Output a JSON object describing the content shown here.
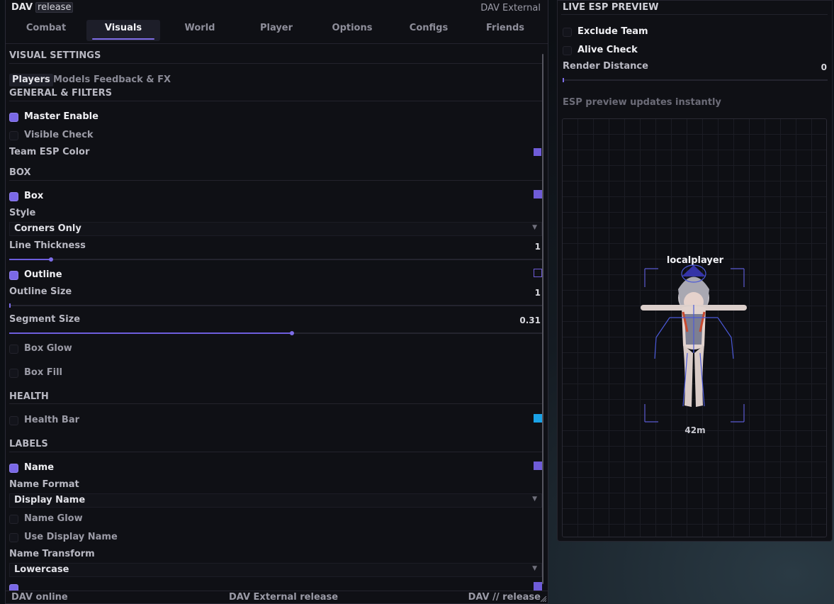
{
  "app": {
    "name": "DAV",
    "channel": "release",
    "right_title": "DAV External"
  },
  "tabs": [
    {
      "label": "Combat"
    },
    {
      "label": "Visuals",
      "active": true
    },
    {
      "label": "World"
    },
    {
      "label": "Player"
    },
    {
      "label": "Options"
    },
    {
      "label": "Configs"
    },
    {
      "label": "Friends"
    }
  ],
  "visual": {
    "section_title": "VISUAL SETTINGS",
    "subtabs": [
      {
        "label": "Players",
        "active": true
      },
      {
        "label": "Models"
      },
      {
        "label": "Feedback & FX"
      }
    ],
    "general": {
      "title": "GENERAL & FILTERS",
      "master_enable": {
        "label": "Master Enable",
        "checked": true
      },
      "visible_check": {
        "label": "Visible Check",
        "checked": false
      },
      "team_esp_color": {
        "label": "Team ESP Color",
        "color": "#6f5cd8"
      }
    },
    "box": {
      "title": "BOX",
      "box": {
        "label": "Box",
        "checked": true,
        "color": "#6f5cd8"
      },
      "style": {
        "label": "Style",
        "value": "Corners Only"
      },
      "line_thickness": {
        "label": "Line Thickness",
        "value": "1",
        "fraction": 0.078
      },
      "outline": {
        "label": "Outline",
        "checked": true,
        "color": "#0f1015"
      },
      "outline_size": {
        "label": "Outline Size",
        "value": "1",
        "fraction": 0.0
      },
      "segment_size": {
        "label": "Segment Size",
        "value": "0.31",
        "fraction": 0.53
      },
      "box_glow": {
        "label": "Box Glow",
        "checked": false
      },
      "box_fill": {
        "label": "Box Fill",
        "checked": false
      }
    },
    "health": {
      "title": "HEALTH",
      "health_bar": {
        "label": "Health Bar",
        "checked": false,
        "color": "#1aa3e8"
      }
    },
    "labels": {
      "title": "LABELS",
      "name": {
        "label": "Name",
        "checked": true,
        "color": "#6f5cd8"
      },
      "name_format": {
        "label": "Name Format",
        "value": "Display Name"
      },
      "name_glow": {
        "label": "Name Glow",
        "checked": false
      },
      "use_display_name": {
        "label": "Use Display Name",
        "checked": false
      },
      "name_transform": {
        "label": "Name Transform",
        "value": "Lowercase"
      }
    }
  },
  "status": {
    "left": "DAV online",
    "center": "DAV External release",
    "right": "DAV // release"
  },
  "preview": {
    "title": "LIVE ESP PREVIEW",
    "exclude_team": {
      "label": "Exclude Team",
      "checked": false
    },
    "alive_check": {
      "label": "Alive Check",
      "checked": false
    },
    "render_distance": {
      "label": "Render Distance",
      "value": "0",
      "fraction": 0.0
    },
    "note": "ESP preview updates instantly",
    "player_name": "localplayer",
    "player_distance": "42m"
  },
  "colors": {
    "accent": "#7a68e6",
    "background": "#0f1015"
  }
}
